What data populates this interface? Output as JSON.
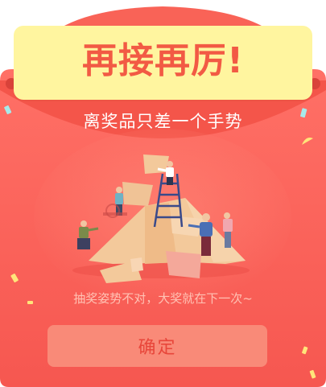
{
  "dialog": {
    "title": "再接再厉!",
    "subtitle": "离奖品只差一个手势",
    "hint": "抽奖姿势不对，大奖就在下一次~",
    "confirm_label": "确定"
  },
  "colors": {
    "card_top": "#ff6f63",
    "card_bottom": "#f65a52",
    "banner": "#fff59f",
    "title": "#f25a44",
    "button": "#f98a78",
    "button_text": "#e8463a",
    "hint_text": "#ffc2b4"
  },
  "icons": [
    "confetti-icon",
    "puzzle-team-illustration"
  ]
}
